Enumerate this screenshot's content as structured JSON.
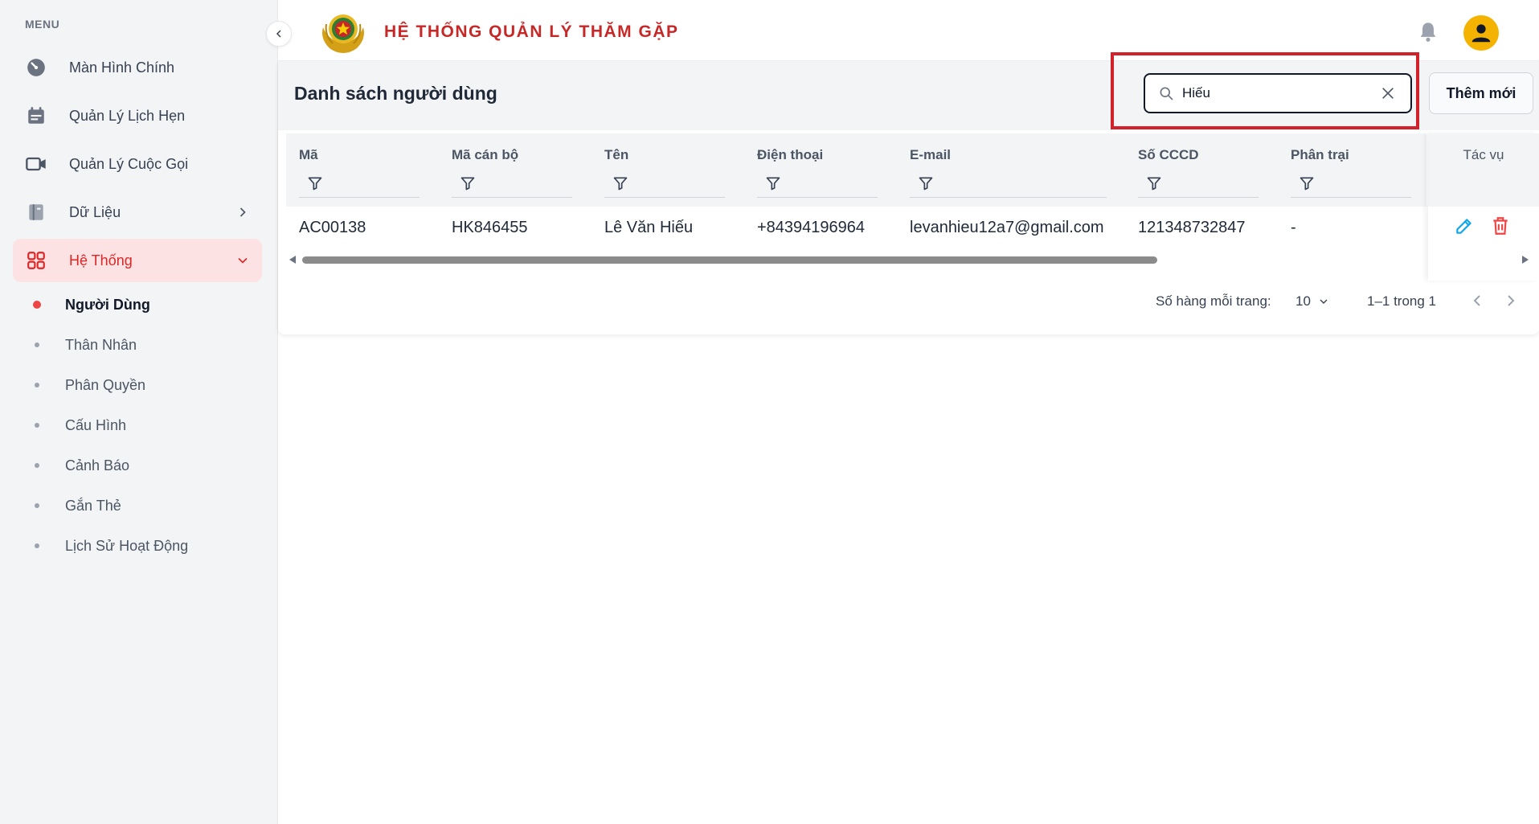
{
  "sidebar": {
    "menu_label": "MENU",
    "items": [
      {
        "label": "Màn Hình Chính",
        "icon": "dashboard-icon"
      },
      {
        "label": "Quản Lý Lịch Hẹn",
        "icon": "calendar-icon"
      },
      {
        "label": "Quản Lý Cuộc Gọi",
        "icon": "video-camera-icon"
      },
      {
        "label": "Dữ Liệu",
        "icon": "database-icon"
      },
      {
        "label": "Hệ Thống",
        "icon": "grid-icon"
      }
    ],
    "sub_items": [
      {
        "label": "Người Dùng"
      },
      {
        "label": "Thân Nhân"
      },
      {
        "label": "Phân Quyền"
      },
      {
        "label": "Cấu Hình"
      },
      {
        "label": "Cảnh Báo"
      },
      {
        "label": "Gắn Thẻ"
      },
      {
        "label": "Lịch Sử Hoạt Động"
      }
    ]
  },
  "header": {
    "title": "HỆ THỐNG QUẢN LÝ THĂM GẶP"
  },
  "page": {
    "title": "Danh sách người dùng",
    "search_value": "Hiếu",
    "add_button": "Thêm mới"
  },
  "table": {
    "columns": [
      "Mã",
      "Mã cán bộ",
      "Tên",
      "Điện thoại",
      "E-mail",
      "Số CCCD",
      "Phân trại"
    ],
    "action_column": "Tác vụ",
    "rows": [
      [
        "AC00138",
        "HK846455",
        "Lê Văn Hiếu",
        "+84394196964",
        "levanhieu12a7@gmail.com",
        "121348732847",
        "-"
      ]
    ]
  },
  "pagination": {
    "rows_per_page_label": "Số hàng mỗi trang:",
    "rows_per_page": "10",
    "range": "1–1 trong 1"
  },
  "colors": {
    "brand_red": "#c62828",
    "active_bg": "#fde2e4",
    "edit_blue": "#0ea5e9",
    "delete_red": "#ef4444",
    "avatar_yellow": "#f5b301"
  }
}
